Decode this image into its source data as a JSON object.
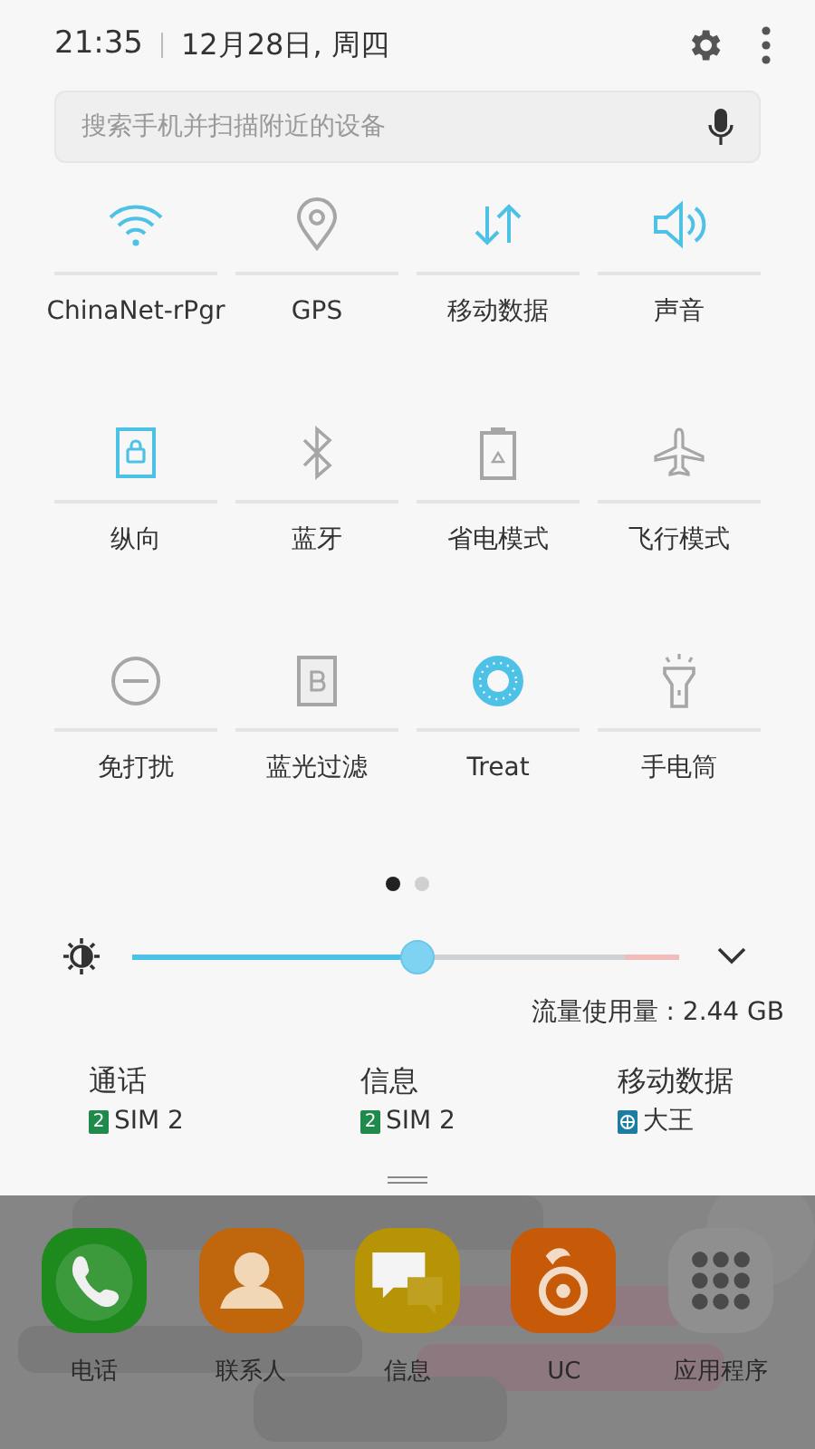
{
  "header": {
    "time": "21:35",
    "date": "12月28日, 周四"
  },
  "search": {
    "placeholder": "搜索手机并扫描附近的设备"
  },
  "tiles": [
    {
      "kind": "wifi",
      "label": "ChinaNet-rPgr",
      "on": true
    },
    {
      "kind": "gps",
      "label": "GPS",
      "on": false
    },
    {
      "kind": "data",
      "label": "移动数据",
      "on": true
    },
    {
      "kind": "sound",
      "label": "声音",
      "on": true
    },
    {
      "kind": "portrait",
      "label": "纵向",
      "on": true
    },
    {
      "kind": "bluetooth",
      "label": "蓝牙",
      "on": false
    },
    {
      "kind": "battery",
      "label": "省电模式",
      "on": false
    },
    {
      "kind": "airplane",
      "label": "飞行模式",
      "on": false
    },
    {
      "kind": "dnd",
      "label": "免打扰",
      "on": false
    },
    {
      "kind": "bluelight",
      "label": "蓝光过滤",
      "on": false
    },
    {
      "kind": "donut",
      "label": "Treat",
      "on": true
    },
    {
      "kind": "flashlight",
      "label": "手电筒",
      "on": false
    }
  ],
  "pages": [
    {
      "selected": true
    },
    {
      "selected": false
    }
  ],
  "brightness": {
    "level": 0.52
  },
  "data_usage": "流量使用量 : 2.44 GB",
  "sim": [
    {
      "label": "通话",
      "kind": "sim",
      "badge": "2",
      "value": "SIM 2"
    },
    {
      "label": "信息",
      "kind": "sim",
      "badge": "2",
      "value": "SIM 2"
    },
    {
      "label": "移动数据",
      "kind": "globe",
      "value": "大王"
    }
  ],
  "dock": [
    {
      "kind": "phone",
      "label": "电话"
    },
    {
      "kind": "contacts",
      "label": "联系人"
    },
    {
      "kind": "messages",
      "label": "信息"
    },
    {
      "kind": "uc",
      "label": "UC"
    },
    {
      "kind": "apps",
      "label": "应用程序"
    }
  ]
}
